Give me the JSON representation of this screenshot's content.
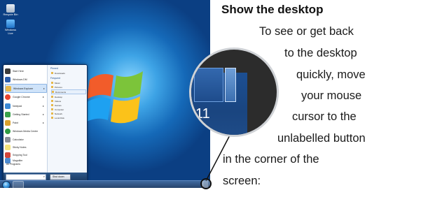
{
  "heading": "Show the desktop",
  "body_lines": [
    "To see or get back",
    "to the desktop",
    "quickly, move",
    "your mouse",
    "cursor to the",
    "unlabelled button",
    "in the corner of the",
    "screen:"
  ],
  "zoom_label": "11",
  "desktop_icons": [
    "Recycle Bin",
    "Windows Live"
  ],
  "start_menu": {
    "programs": [
      "Getting Started",
      "Windows Media Center",
      "Calculator",
      "Sticky Notes",
      "Snipping Tool",
      "Paint",
      "Remote Desktop",
      "Magnifier",
      "Solitaire"
    ],
    "programs_visible": [
      "Start Here",
      "Windows DM",
      "Windows Explorer",
      "Google Chrome",
      "Notepad",
      "Getting Started",
      "Paint",
      "Windows Media Center",
      "Calculator",
      "Sticky Notes",
      "Snipping Tool",
      "Magnifier"
    ],
    "all_programs": "All Programs",
    "search_placeholder": "Search programs and files",
    "shutdown_label": "Shut down",
    "jumplist_pinned_title": "Pinned",
    "jumplist_recent_title": "Frequent",
    "jumplist_items": [
      "Downloads",
      "Music",
      "Pictures",
      "Documents",
      "Desktop",
      "Videos",
      "Games",
      "Computer",
      "Network",
      "Local Disk"
    ]
  },
  "colors": {
    "desktop": "#1569b8",
    "taskbar": "#243f66",
    "zoom_background": "#2c2c2c",
    "highlight": "#cfe3f9"
  }
}
